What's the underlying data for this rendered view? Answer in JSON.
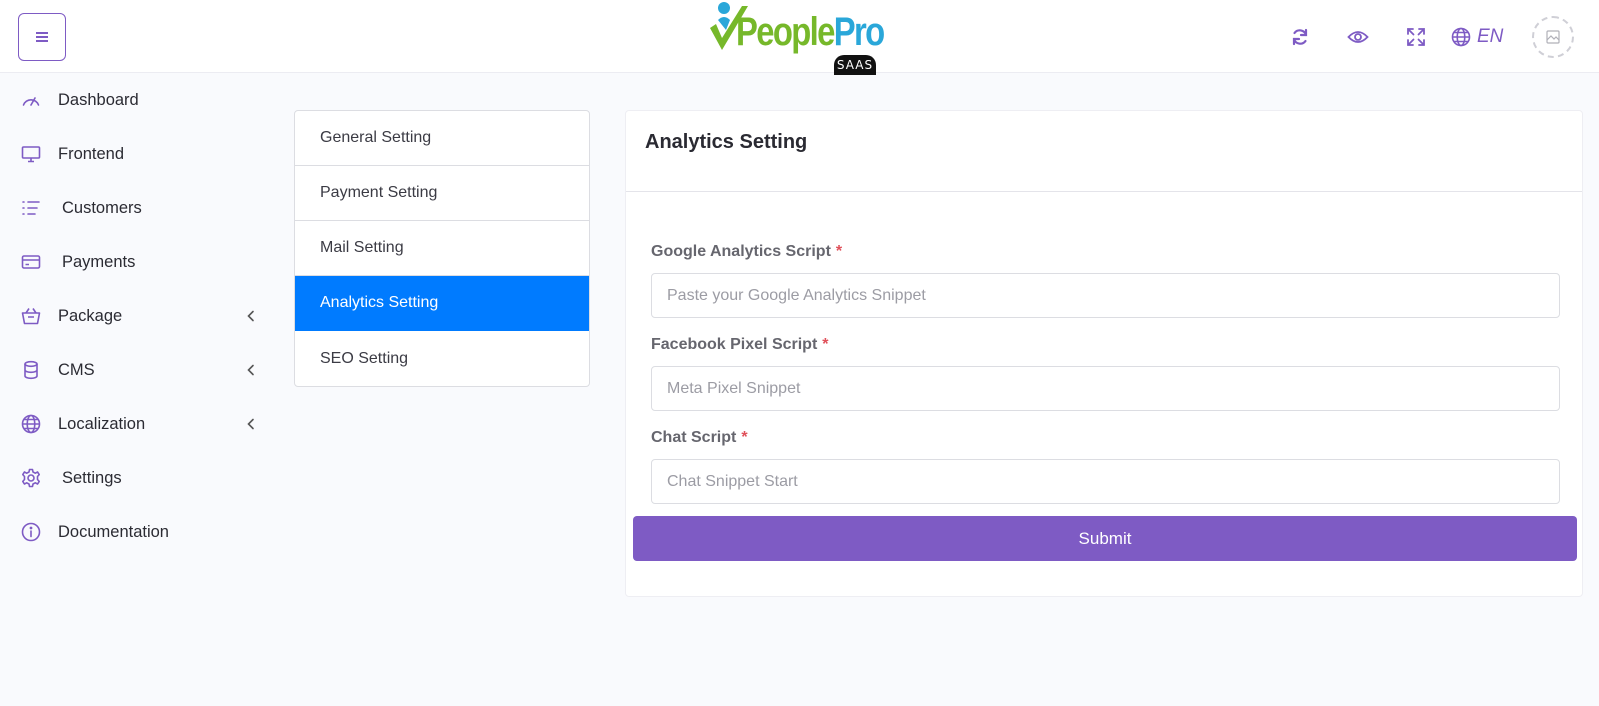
{
  "brand": {
    "name_part1": "People",
    "name_part2": "Pro",
    "badge": "SAAS",
    "colors": {
      "green": "#76b82a",
      "blue": "#2aa7d9"
    }
  },
  "header": {
    "menu_icon": "hamburger-icon",
    "icons": [
      "refresh-icon",
      "eye-icon",
      "fullscreen-icon",
      "globe-icon"
    ],
    "language": "EN",
    "accent_color": "#7e5bc4"
  },
  "sidebar": {
    "items": [
      {
        "label": "Dashboard",
        "icon": "speedometer-icon",
        "has_submenu": false
      },
      {
        "label": "Frontend",
        "icon": "monitor-icon",
        "has_submenu": false
      },
      {
        "label": "Customers",
        "icon": "list-icon",
        "has_submenu": false
      },
      {
        "label": "Payments",
        "icon": "credit-card-icon",
        "has_submenu": false
      },
      {
        "label": "Package",
        "icon": "basket-icon",
        "has_submenu": true
      },
      {
        "label": "CMS",
        "icon": "database-icon",
        "has_submenu": true
      },
      {
        "label": "Localization",
        "icon": "globe-icon",
        "has_submenu": true
      },
      {
        "label": "Settings",
        "icon": "gear-icon",
        "has_submenu": false
      },
      {
        "label": "Documentation",
        "icon": "info-icon",
        "has_submenu": false
      }
    ]
  },
  "settings_menu": {
    "items": [
      {
        "label": "General Setting",
        "active": false
      },
      {
        "label": "Payment Setting",
        "active": false
      },
      {
        "label": "Mail Setting",
        "active": false
      },
      {
        "label": "Analytics Setting",
        "active": true
      },
      {
        "label": "SEO Setting",
        "active": false
      }
    ],
    "active_color": "#007bff"
  },
  "card": {
    "title": "Analytics Setting",
    "fields": [
      {
        "label": "Google Analytics Script",
        "required_mark": "*",
        "value": "",
        "placeholder": "Paste your Google Analytics Snippet"
      },
      {
        "label": "Facebook Pixel Script",
        "required_mark": "*",
        "value": "",
        "placeholder": "Meta Pixel Snippet"
      },
      {
        "label": "Chat Script",
        "required_mark": "*",
        "value": "",
        "placeholder": "Chat Snippet Start"
      }
    ],
    "submit_label": "Submit"
  }
}
